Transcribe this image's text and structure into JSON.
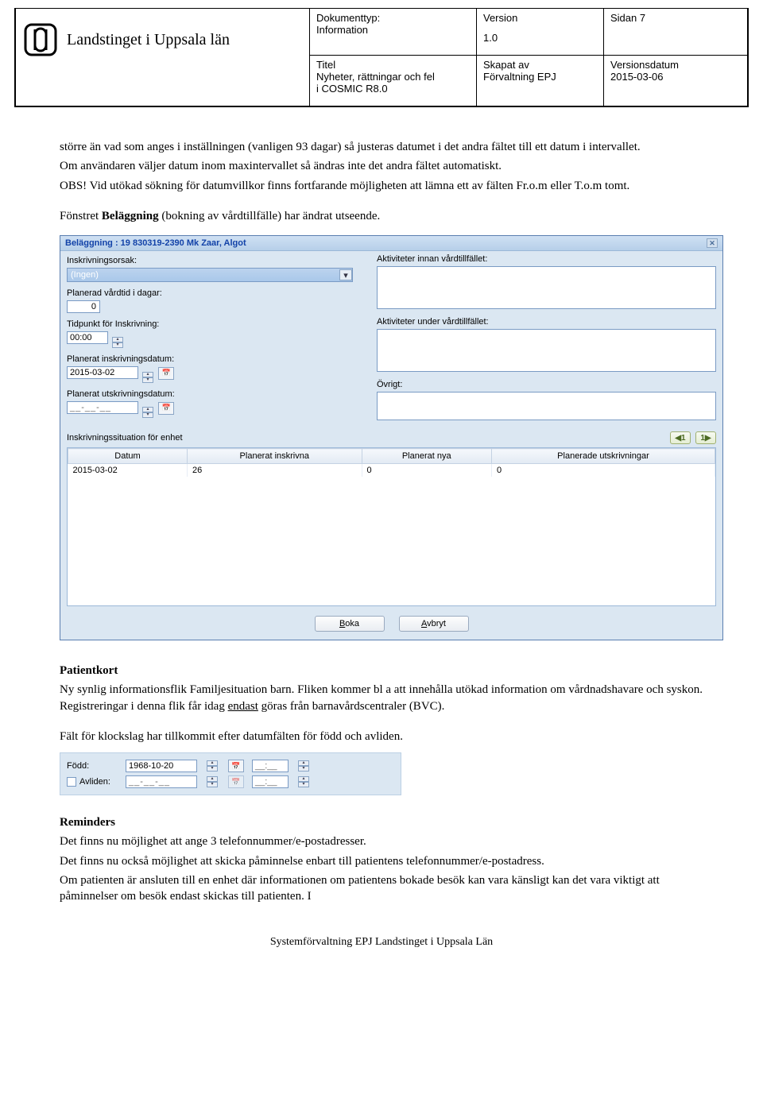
{
  "header": {
    "org_name": "Landstinget i Uppsala län",
    "doctype_label": "Dokumenttyp:",
    "doctype_value": "Information",
    "title_label": "Titel",
    "title_value1": "Nyheter, rättningar och fel",
    "title_value2": "i COSMIC R8.0",
    "version_label": "Version",
    "version_value": "1.0",
    "created_label": "Skapat av",
    "created_value": "Förvaltning EPJ",
    "page_label": "Sidan 7",
    "vdate_label": "Versionsdatum",
    "vdate_value": "2015-03-06"
  },
  "body": {
    "p1a": "större än vad som anges i inställningen (vanligen 93 dagar) så justeras datumet i det andra fältet till ett datum i intervallet.",
    "p1b": "Om användaren väljer datum inom maxintervallet så ändras inte det andra fältet automatiskt.",
    "p1c": "OBS! Vid utökad sökning för datumvillkor finns fortfarande möjligheten att lämna ett av fälten Fr.o.m eller T.o.m tomt.",
    "p2a": "Fönstret ",
    "p2b": "Beläggning",
    "p2c": " (bokning av vårdtillfälle) har ändrat utseende.",
    "h_patientkort": "Patientkort",
    "p3": "Ny synlig informationsflik Familjesituation barn. Fliken kommer bl a att innehålla utökad information om vårdnadshavare och syskon. Registreringar i denna flik får idag ",
    "p3u": "endast",
    "p3b": " göras från barnavårdscentraler (BVC).",
    "p4": "Fält för klockslag har tillkommit efter datumfälten för född och avliden.",
    "h_reminders": "Reminders",
    "p5": "Det finns nu möjlighet att ange 3 telefonnummer/e-postadresser.",
    "p6": "Det finns nu också möjlighet att skicka påminnelse enbart till patientens telefonnummer/e-postadress.",
    "p7": "Om patienten är ansluten till en enhet där informationen om patientens bokade besök kan vara känsligt kan det vara viktigt att påminnelser om besök endast skickas till patienten. I",
    "footer": "Systemförvaltning EPJ Landstinget i Uppsala Län"
  },
  "shot1": {
    "title": "Beläggning : 19 830319-2390 Mk Zaar, Algot",
    "insk_orsak_label": "Inskrivningsorsak:",
    "insk_orsak_value": "(Ingen)",
    "planerad_dagar_label": "Planerad vårdtid i dagar:",
    "planerad_dagar_value": "0",
    "tidpunkt_label": "Tidpunkt för Inskrivning:",
    "tidpunkt_value": "00:00",
    "plan_insk_label": "Planerat inskrivningsdatum:",
    "plan_insk_value": "2015-03-02",
    "plan_utsk_label": "Planerat utskrivningsdatum:",
    "plan_utsk_value": "__-__-__",
    "akt_innan_label": "Aktiviteter innan vårdtillfället:",
    "akt_under_label": "Aktiviteter under vårdtillfället:",
    "ovrigt_label": "Övrigt:",
    "sect_label": "Inskrivningssituation för enhet",
    "nav_prev": "◀1",
    "nav_next": "1▶",
    "cols": {
      "c0": "Datum",
      "c1": "Planerat inskrivna",
      "c2": "Planerat nya",
      "c3": "Planerade utskrivningar"
    },
    "row": {
      "c0": "2015-03-02",
      "c1": "26",
      "c2": "0",
      "c3": "0"
    },
    "btn_boka_m": "B",
    "btn_boka_rest": "oka",
    "btn_avbryt_m": "A",
    "btn_avbryt_rest": "vbryt"
  },
  "shot2": {
    "fodd_label": "Född:",
    "fodd_date": "1968-10-20",
    "time_placeholder": "__:__",
    "avliden_label": "Avliden:",
    "avliden_date": "__-__-__"
  }
}
